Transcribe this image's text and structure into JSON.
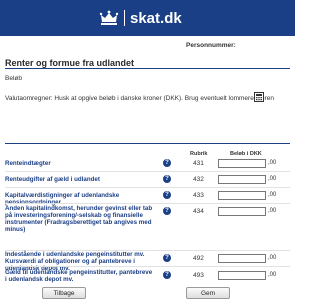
{
  "header": {
    "logo_text": "skat.dk",
    "brand_color": "#1b3f86"
  },
  "personnummer_label": "Personnummer:",
  "section_title": "Renter og formue fra udlandet",
  "beloeb_label": "Beløb",
  "valuta_note": "Valutaomregner: Husk at opgive beløb i danske kroner (DKK). Brug eventuelt lommeregneren",
  "columns": {
    "rubrik": "Rubrik",
    "beloeb": "Beløb i DKK"
  },
  "rows": [
    {
      "label": "Renteindtægter",
      "rubrik": "431",
      "value": "",
      "decimals": ",00"
    },
    {
      "label": "Renteudgifter af gæld i udlandet",
      "rubrik": "432",
      "value": "",
      "decimals": ",00"
    },
    {
      "label": "Kapitalværdistigninger af udenlandske pensionsordninger",
      "rubrik": "433",
      "value": "",
      "decimals": ",00"
    },
    {
      "label": "Anden kapitalindkomst, herunder gevinst eller tab på investeringsforening/-selskab og finansielle instrumenter (Fradragsberettiget tab angives med minus)",
      "rubrik": "434",
      "value": "",
      "decimals": ",00"
    },
    {
      "label": "Indestående i udenlandske pengeinstitutter mv. Kursværdi af obligationer og af pantebreve i udenlandsk depot mv.",
      "rubrik": "492",
      "value": "",
      "decimals": ",00"
    },
    {
      "label": "Gæld til udenlandske pengeinstitutter, pantebreve i udenlandsk depot mv.",
      "rubrik": "493",
      "value": "",
      "decimals": ",00"
    }
  ],
  "help_glyph": "?",
  "buttons": {
    "back": "Tilbage",
    "save": "Gem"
  },
  "icons": {
    "logo": "crown-icon",
    "calculator": "calculator-icon",
    "help": "help-icon"
  }
}
